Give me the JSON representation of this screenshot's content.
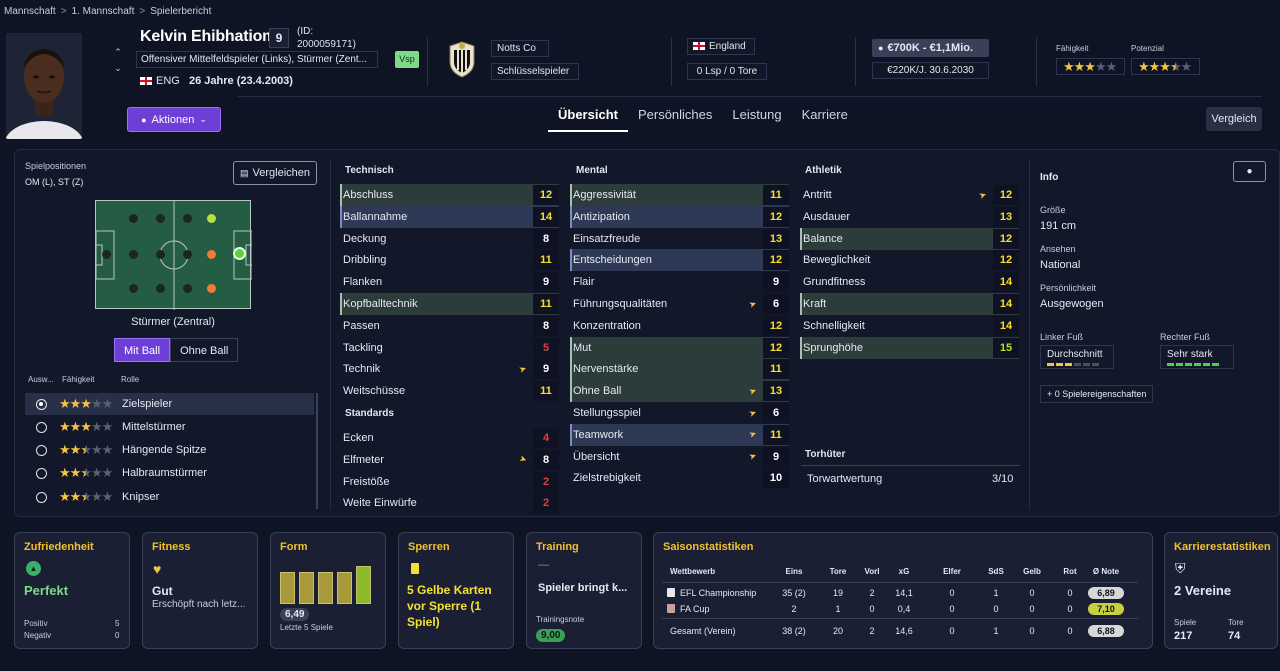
{
  "breadcrumb": {
    "items": [
      "Mannschaft",
      "1. Mannschaft",
      "Spielerbericht"
    ]
  },
  "player": {
    "name": "Kelvin Ehibhatiom...",
    "shirt": "9",
    "id_line1": "(ID:",
    "id_line2": "2000059171)",
    "position": "Offensiver Mittelfeldspieler (Links), Stürmer (Zent...",
    "badge": "Vsp",
    "nat_code": "ENG",
    "age": "26 Jahre (23.4.2003)"
  },
  "club": {
    "name": "Notts Co",
    "status": "Schlüsselspieler"
  },
  "nation": {
    "name": "England",
    "caps": "0 Lsp / 0 Tore"
  },
  "contract": {
    "value": "€700K - €1,1Mio.",
    "wage": "€220K/J. 30.6.2030"
  },
  "ratings": {
    "ability_label": "Fähigkeit",
    "potential_label": "Potenzial",
    "ability": 3,
    "potential": 3.5
  },
  "actions_label": "Aktionen",
  "tabs": [
    {
      "label": "Übersicht",
      "active": true
    },
    {
      "label": "Persönliches"
    },
    {
      "label": "Leistung"
    },
    {
      "label": "Karriere"
    }
  ],
  "compare_top": "Vergleich",
  "positions": {
    "label": "Spielpositionen",
    "value": "OM (L), ST (Z)",
    "compare": "Vergleichen",
    "pitch_label": "Stürmer (Zentral)",
    "mit_ball": "Mit Ball",
    "ohne_ball": "Ohne Ball"
  },
  "roles": {
    "headers": [
      "Ausw...",
      "Fähigkeit",
      "Rolle"
    ],
    "items": [
      {
        "name": "Zielspieler",
        "stars": 3,
        "selected": true
      },
      {
        "name": "Mittelstürmer",
        "stars": 3
      },
      {
        "name": "Hängende Spitze",
        "stars": 2.5
      },
      {
        "name": "Halbraumstürmer",
        "stars": 2.5
      },
      {
        "name": "Knipser",
        "stars": 2.5
      }
    ]
  },
  "technisch": {
    "title": "Technisch",
    "items": [
      {
        "n": "Abschluss",
        "v": "12",
        "c": "y",
        "h": "g"
      },
      {
        "n": "Ballannahme",
        "v": "14",
        "c": "y",
        "h": "b"
      },
      {
        "n": "Deckung",
        "v": "8",
        "c": "w"
      },
      {
        "n": "Dribbling",
        "v": "11",
        "c": "y"
      },
      {
        "n": "Flanken",
        "v": "9",
        "c": "w"
      },
      {
        "n": "Kopfballtechnik",
        "v": "11",
        "c": "y",
        "h": "g"
      },
      {
        "n": "Passen",
        "v": "8",
        "c": "w"
      },
      {
        "n": "Tackling",
        "v": "5",
        "c": "r"
      },
      {
        "n": "Technik",
        "v": "9",
        "c": "w",
        "s": "up"
      },
      {
        "n": "Weitschüsse",
        "v": "11",
        "c": "y"
      }
    ]
  },
  "standards": {
    "title": "Standards",
    "items": [
      {
        "n": "Ecken",
        "v": "4",
        "c": "r"
      },
      {
        "n": "Elfmeter",
        "v": "8",
        "c": "w",
        "s": "down"
      },
      {
        "n": "Freistöße",
        "v": "2",
        "c": "r"
      },
      {
        "n": "Weite Einwürfe",
        "v": "2",
        "c": "r"
      }
    ]
  },
  "mental": {
    "title": "Mental",
    "items": [
      {
        "n": "Aggressivität",
        "v": "11",
        "c": "y",
        "h": "g"
      },
      {
        "n": "Antizipation",
        "v": "12",
        "c": "y",
        "h": "b"
      },
      {
        "n": "Einsatzfreude",
        "v": "13",
        "c": "y"
      },
      {
        "n": "Entscheidungen",
        "v": "12",
        "c": "y",
        "h": "b"
      },
      {
        "n": "Flair",
        "v": "9",
        "c": "w"
      },
      {
        "n": "Führungsqualitäten",
        "v": "6",
        "c": "w",
        "s": "up"
      },
      {
        "n": "Konzentration",
        "v": "12",
        "c": "y"
      },
      {
        "n": "Mut",
        "v": "12",
        "c": "y",
        "h": "g"
      },
      {
        "n": "Nervenstärke",
        "v": "11",
        "c": "y",
        "h": "g"
      },
      {
        "n": "Ohne Ball",
        "v": "13",
        "c": "y",
        "s": "up",
        "h": "g"
      },
      {
        "n": "Stellungsspiel",
        "v": "6",
        "c": "w",
        "s": "up"
      },
      {
        "n": "Teamwork",
        "v": "11",
        "c": "y",
        "s": "up",
        "h": "b"
      },
      {
        "n": "Übersicht",
        "v": "9",
        "c": "w",
        "s": "up"
      },
      {
        "n": "Zielstrebigkeit",
        "v": "10",
        "c": "w"
      }
    ]
  },
  "athletik": {
    "title": "Athletik",
    "items": [
      {
        "n": "Antritt",
        "v": "12",
        "c": "y",
        "s": "up"
      },
      {
        "n": "Ausdauer",
        "v": "13",
        "c": "y"
      },
      {
        "n": "Balance",
        "v": "12",
        "c": "y",
        "h": "g"
      },
      {
        "n": "Beweglichkeit",
        "v": "12",
        "c": "y"
      },
      {
        "n": "Grundfitness",
        "v": "14",
        "c": "y"
      },
      {
        "n": "Kraft",
        "v": "14",
        "c": "y",
        "h": "g"
      },
      {
        "n": "Schnelligkeit",
        "v": "14",
        "c": "y"
      },
      {
        "n": "Sprunghöhe",
        "v": "15",
        "c": "l",
        "h": "g"
      }
    ]
  },
  "torhueter": {
    "title": "Torhüter",
    "label": "Torwartwertung",
    "value": "3/10"
  },
  "info": {
    "title": "Info",
    "groesse_l": "Größe",
    "groesse": "191 cm",
    "ansehen_l": "Ansehen",
    "ansehen": "National",
    "pers_l": "Persönlichkeit",
    "pers": "Ausgewogen",
    "lf_l": "Linker Fuß",
    "lf": "Durchschnitt",
    "lf_level": 0.5,
    "rf_l": "Rechter Fuß",
    "rf": "Sehr stark",
    "rf_level": 1,
    "traits": "0 Spielereigenschaften"
  },
  "cards": {
    "zufriedenheit": {
      "title": "Zufriedenheit",
      "value": "Perfekt",
      "pos_l": "Positiv",
      "pos": "5",
      "neg_l": "Negativ",
      "neg": "0"
    },
    "fitness": {
      "title": "Fitness",
      "value": "Gut",
      "sub": "Erschöpft nach letz..."
    },
    "form": {
      "title": "Form",
      "value": "6,49",
      "sub": "Letzte 5 Spiele",
      "levels": [
        0.8,
        0.8,
        0.8,
        0.8,
        0.95
      ]
    },
    "sperren": {
      "title": "Sperren",
      "value": "5 Gelbe Karten vor Sperre (1 Spiel)"
    },
    "training": {
      "title": "Training",
      "dash": "—",
      "value": "Spieler bringt k...",
      "note_l": "Trainingsnote",
      "note": "9,00"
    },
    "saison": {
      "title": "Saisonstatistiken",
      "headers": [
        "Wettbewerb",
        "Eins",
        "Tore",
        "Vorl",
        "xG",
        "Elfer",
        "SdS",
        "Gelb",
        "Rot",
        "Ø Note"
      ],
      "rows": [
        [
          "EFL Championship",
          "35 (2)",
          "19",
          "2",
          "14,1",
          "0",
          "1",
          "0",
          "0",
          "6,89"
        ],
        [
          "FA Cup",
          "2",
          "1",
          "0",
          "0,4",
          "0",
          "0",
          "0",
          "0",
          "7,10"
        ],
        [
          "Gesamt (Verein)",
          "38 (2)",
          "20",
          "2",
          "14,6",
          "0",
          "1",
          "0",
          "0",
          "6,88"
        ]
      ]
    },
    "karriere": {
      "title": "Karrierestatistiken",
      "value": "2 Vereine",
      "sp_l": "Spiele",
      "sp": "217",
      "to_l": "Tore",
      "to": "74"
    }
  }
}
